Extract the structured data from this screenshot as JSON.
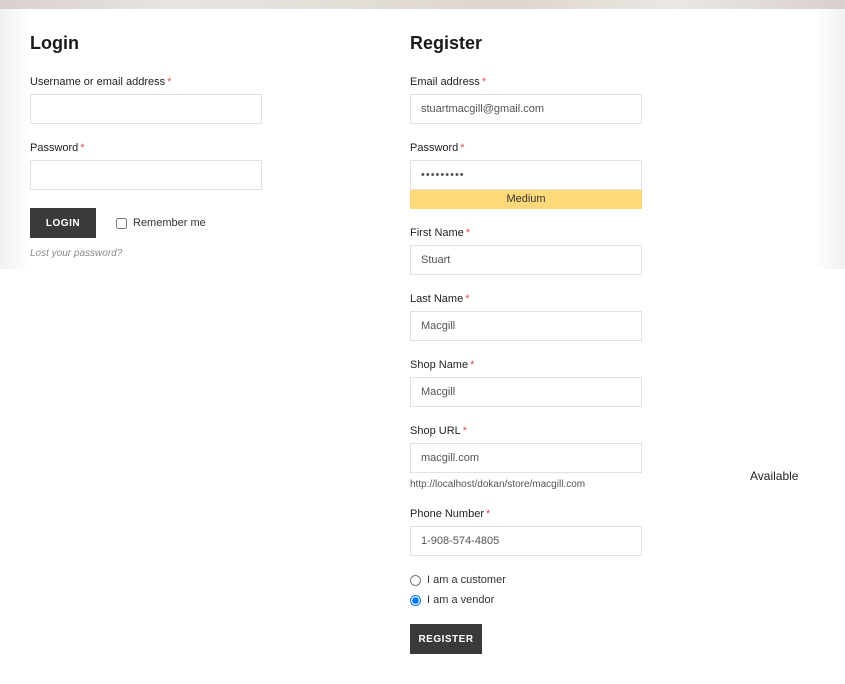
{
  "login": {
    "title": "Login",
    "username_label": "Username or email address",
    "username_value": "",
    "password_label": "Password",
    "password_value": "",
    "button": "LOGIN",
    "remember": "Remember me",
    "lost": "Lost your password?"
  },
  "register": {
    "title": "Register",
    "email_label": "Email address",
    "email_value": "stuartmacgill@gmail.com",
    "password_label": "Password",
    "password_value": "•••••••••",
    "strength": "Medium",
    "firstname_label": "First Name",
    "firstname_value": "Stuart",
    "lastname_label": "Last Name",
    "lastname_value": "Macgill",
    "shopname_label": "Shop Name",
    "shopname_value": "Macgill",
    "shopurl_label": "Shop URL",
    "shopurl_value": "macgill.com",
    "shopurl_hint": "http://localhost/dokan/store/macgill.com",
    "available": "Available",
    "phone_label": "Phone Number",
    "phone_value": "1-908-574-4805",
    "role_customer": "I am a customer",
    "role_vendor": "I am a vendor",
    "button": "REGISTER"
  },
  "required": "*"
}
